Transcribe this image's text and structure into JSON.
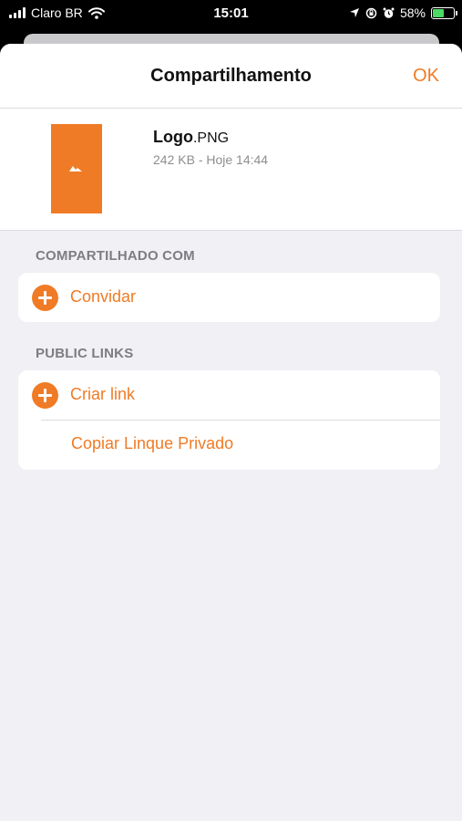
{
  "status_bar": {
    "carrier": "Claro BR",
    "time": "15:01",
    "battery_percent": "58%",
    "battery_level": 0.58,
    "icons": [
      "signal-icon",
      "wifi-icon",
      "location-icon",
      "rotation-lock-icon",
      "alarm-icon",
      "battery-charging-icon"
    ]
  },
  "nav": {
    "title": "Compartilhamento",
    "ok_label": "OK"
  },
  "file": {
    "name": "Logo",
    "extension": ".PNG",
    "meta": "242 KB - Hoje 14:44"
  },
  "shared_with": {
    "header": "COMPARTILHADO COM",
    "invite_label": "Convidar"
  },
  "public_links": {
    "header": "PUBLIC LINKS",
    "create_link_label": "Criar link",
    "copy_private_label": "Copiar Linque Privado"
  },
  "colors": {
    "accent": "#f07b26",
    "background": "#f0f0f5",
    "secondary_text": "#8e8e93"
  }
}
